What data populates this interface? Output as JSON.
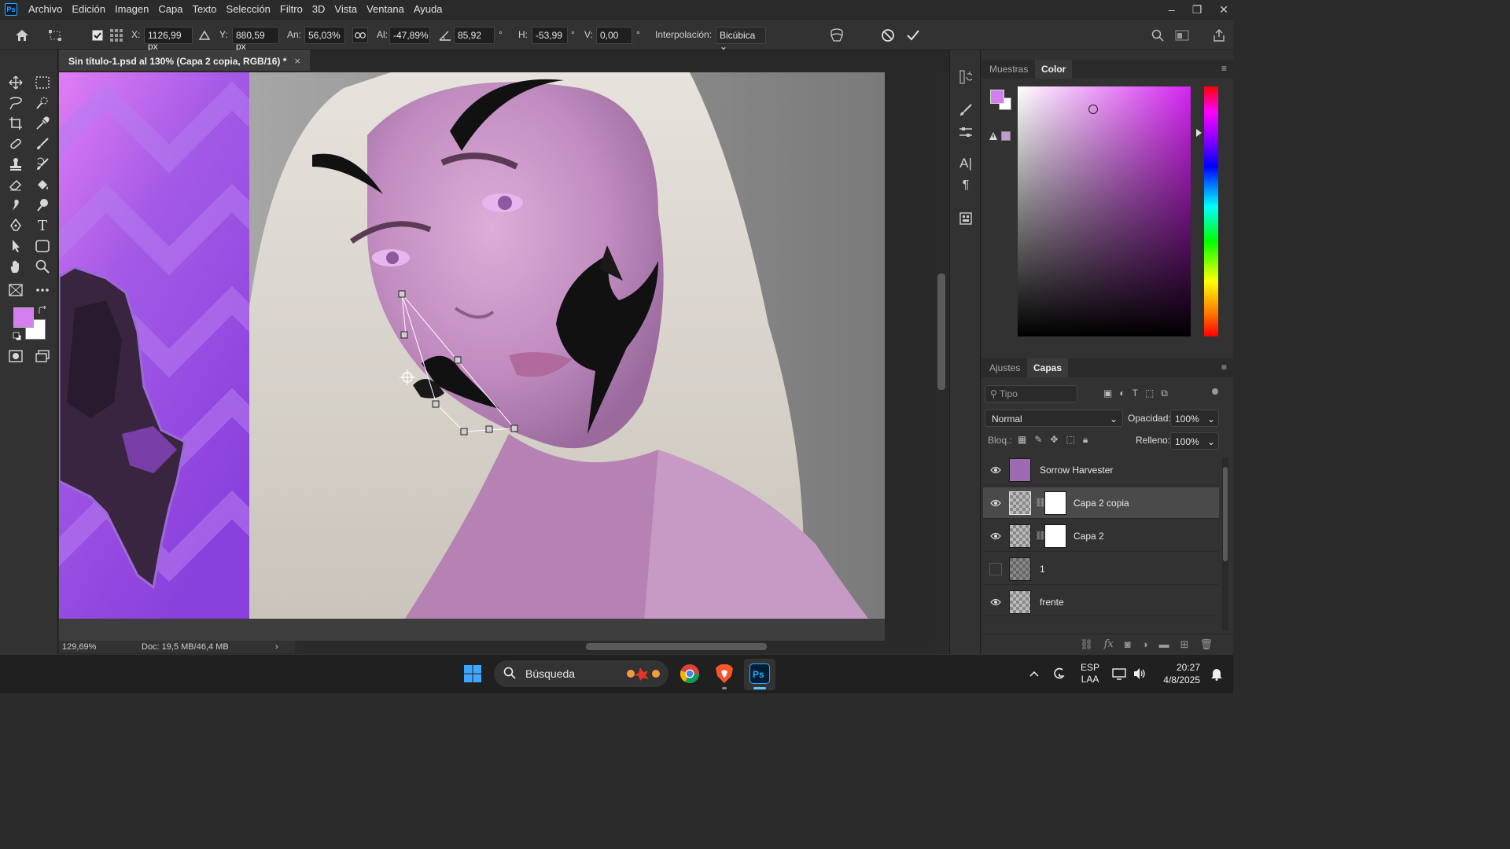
{
  "app": {
    "logo": "Ps"
  },
  "menu": [
    "Archivo",
    "Edición",
    "Imagen",
    "Capa",
    "Texto",
    "Selección",
    "Filtro",
    "3D",
    "Vista",
    "Ventana",
    "Ayuda"
  ],
  "window_controls": {
    "minimize": "–",
    "restore": "❐",
    "close": "✕"
  },
  "options": {
    "x_label": "X:",
    "x_value": "1126,99 px",
    "y_label": "Y:",
    "y_value": "880,59 px",
    "w_label": "An:",
    "w_value": "56,03%",
    "h_label": "Al:",
    "h_value": "-47,89%",
    "angle_value": "85,92",
    "deg1": "°",
    "hskew_label": "H:",
    "hskew_value": "-53,99",
    "deg2": "°",
    "vskew_label": "V:",
    "vskew_value": "0,00",
    "deg3": "°",
    "interp_label": "Interpolación:",
    "interp_value": "Bicúbica"
  },
  "document": {
    "tab_title": "Sin título-1.psd al 130% (Capa 2 copia, RGB/16) *",
    "close": "×"
  },
  "status": {
    "zoom": "129,69%",
    "doc": "Doc: 19,5 MB/46,4 MB",
    "arrow": "›"
  },
  "colors": {
    "foreground": "#d47ef0",
    "background": "#ffffff",
    "accent": "#d524f2"
  },
  "panels_top": {
    "tabs": [
      "Muestras",
      "Color"
    ],
    "active": "Color"
  },
  "panels_bottom": {
    "tabs": [
      "Ajustes",
      "Capas"
    ],
    "active": "Capas",
    "filter_placeholder": "Tipo",
    "blend_mode": "Normal",
    "opacity_label": "Opacidad:",
    "opacity_value": "100%",
    "lock_label": "Bloq.:",
    "fill_label": "Relleno:",
    "fill_value": "100%"
  },
  "layers": [
    {
      "name": "Sorrow Harvester",
      "visible": true,
      "selected": false,
      "mask": false
    },
    {
      "name": "Capa 2 copia",
      "visible": true,
      "selected": true,
      "mask": true
    },
    {
      "name": "Capa 2",
      "visible": true,
      "selected": false,
      "mask": true
    },
    {
      "name": "1",
      "visible": false,
      "selected": false,
      "mask": false
    },
    {
      "name": "frente",
      "visible": true,
      "selected": false,
      "mask": false
    }
  ],
  "taskbar": {
    "search_label": "Búsqueda",
    "lang_top": "ESP",
    "lang_bottom": "LAA",
    "time": "20:27",
    "date": "4/8/2025"
  }
}
